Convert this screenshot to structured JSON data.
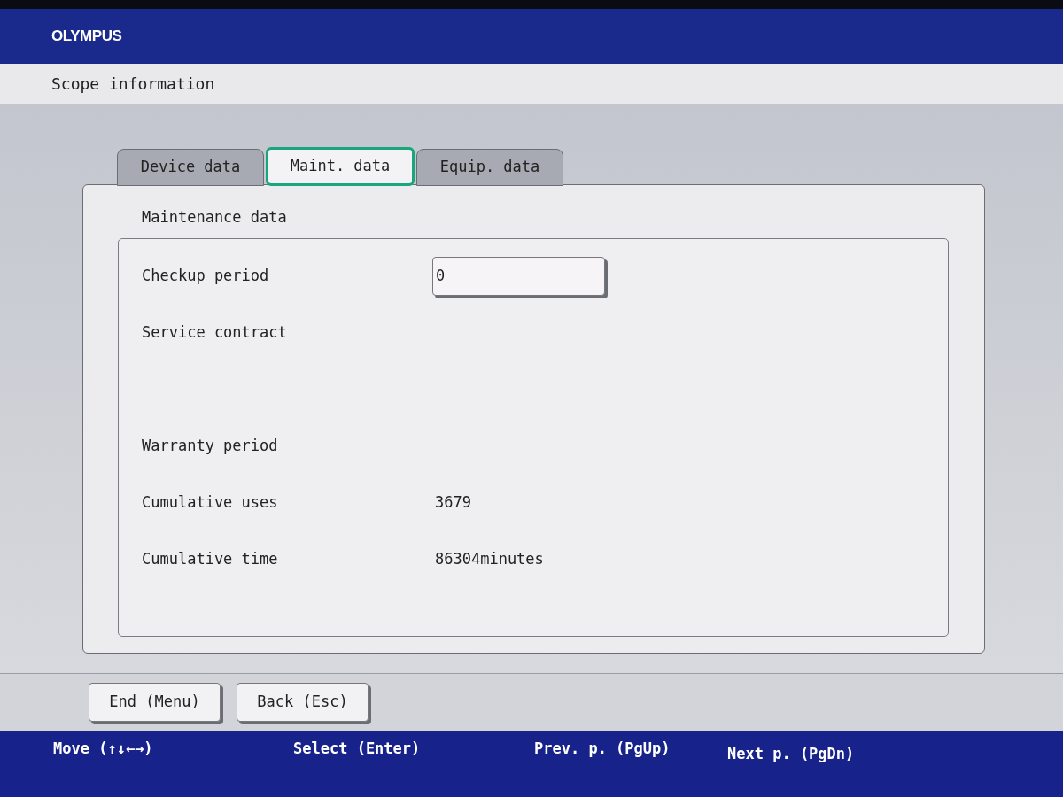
{
  "header": {
    "brand": "OLYMPUS"
  },
  "window": {
    "title": "Scope information"
  },
  "tabs": [
    {
      "label": "Device data",
      "selected": false
    },
    {
      "label": "Maint. data",
      "selected": true
    },
    {
      "label": "Equip. data",
      "selected": false
    }
  ],
  "section": {
    "title": "Maintenance data"
  },
  "rows": [
    {
      "kind": "field",
      "label": "Checkup period",
      "value": "0"
    },
    {
      "kind": "text",
      "label": "Service contract"
    },
    {
      "kind": "gap"
    },
    {
      "kind": "text",
      "label": "Warranty period"
    },
    {
      "kind": "text",
      "label": "Cumulative uses",
      "value": "3679"
    },
    {
      "kind": "text",
      "label": "Cumulative time",
      "value": "86304minutes"
    }
  ],
  "buttons": [
    "End (Menu)",
    "Back (Esc)"
  ],
  "key_hints": [
    "Move (↑↓←→)",
    "Select (Enter)",
    "Prev. p. (PgUp)",
    "Next p. (PgDn)"
  ]
}
